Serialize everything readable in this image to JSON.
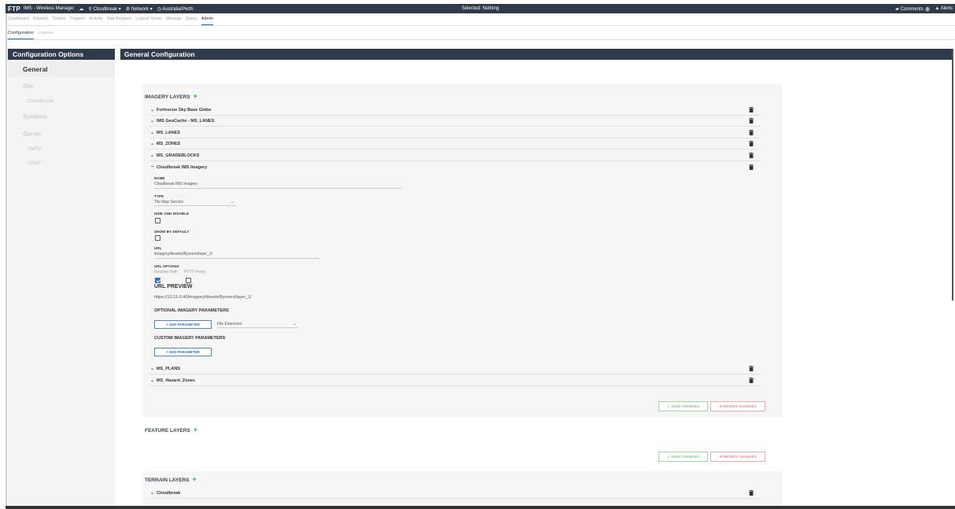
{
  "topbar": {
    "logo": "FTP",
    "app_title": "IMS - Wireless Manager",
    "site": "Cloudbreak",
    "network": "Network",
    "timezone": "Australia/Perth",
    "selected": "Selected: Nothing",
    "comments_label": "Comments",
    "comments_count": "0",
    "alerts_label": "Alerts"
  },
  "nav": {
    "tabs": [
      "Dashboard",
      "Reports",
      "Tickets",
      "Triggers",
      "Activity",
      "Stat Browser",
      "Logical Views",
      "Manage",
      "Query",
      "Admin"
    ]
  },
  "subnav": {
    "tabs": [
      "Configuration",
      "License"
    ]
  },
  "sidebar": {
    "header": "Configuration Options",
    "general": "General",
    "site": "Site",
    "cloudbreak": "Cloudbreak",
    "systems": "Systems",
    "server": "Server",
    "smtp": "SMTP",
    "ldap": "LDAP"
  },
  "main": {
    "header": "General Configuration"
  },
  "imagery": {
    "title": "IMAGERY LAYERS",
    "layers": [
      "Fortescue Sky Base Globe",
      "IMS GeoCache - MS_LANES",
      "MS_LANES",
      "MS_ZONES",
      "MS_GRADEBLOCKS",
      "Cloudbreak IMS Imagery",
      "MS_PLANS",
      "MS_Hazard_Zones"
    ],
    "form": {
      "name_label": "NAME",
      "name_value": "Cloudbreak IMS Imagery",
      "type_label": "TYPE",
      "type_value": "Tile Map Service",
      "hide_label": "HIDE AND DISABLE",
      "show_label": "SHOW BY DEFAULT",
      "url_label": "URL",
      "url_value": "/imagery/tilesets/flyovers/layer_1/",
      "url_options_label": "URL OPTIONS",
      "opt_relative": "Relative Path",
      "opt_proxy": "HTTP Proxy",
      "preview_title": "URL PREVIEW",
      "preview_url": "https://10.15.0.40/imagery/tilesets/flyovers/layer_1/",
      "optional_title": "OPTIONAL IMAGERY PARAMETERS",
      "add_param": "+ ADD PARAMETER",
      "file_ext": "File Extension",
      "custom_title": "CUSTOM IMAGERY PARAMETERS"
    },
    "save": "✔ SAVE CHANGES",
    "revert": "✖ REVERT CHANGES"
  },
  "feature": {
    "title": "FEATURE LAYERS",
    "save": "✔ SAVE CHANGES",
    "revert": "✖ REVERT CHANGES"
  },
  "terrain": {
    "title": "TERRAIN LAYERS",
    "layers": [
      "Cloudbreak"
    ]
  }
}
